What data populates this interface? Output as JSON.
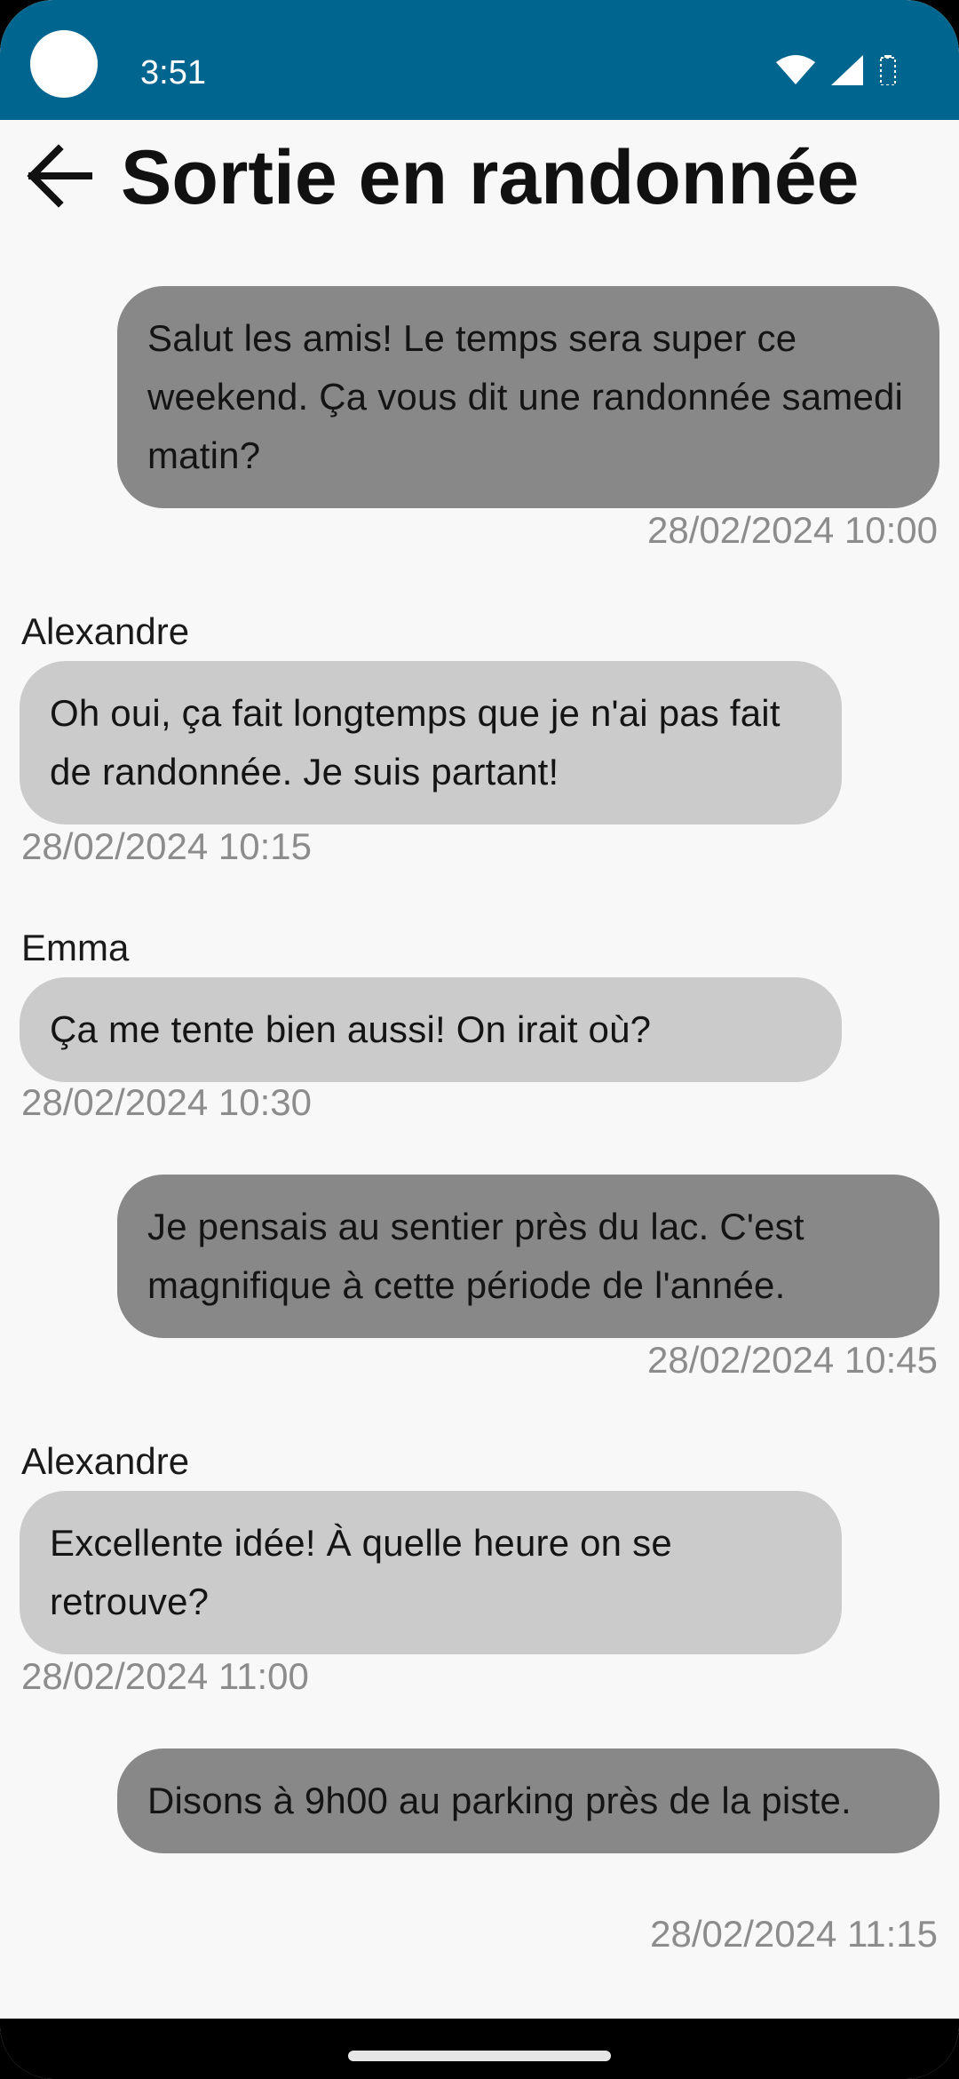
{
  "status_bar": {
    "time": "3:51",
    "icons": [
      "camera-cutout",
      "wifi-icon",
      "signal-icon",
      "battery-icon"
    ]
  },
  "header": {
    "back_icon": "arrow-left-icon",
    "title": "Sortie en randonnée"
  },
  "messages": [
    {
      "direction": "outgoing",
      "sender": "",
      "text": "Salut les amis! Le temps sera super ce weekend. Ça vous dit une randonnée samedi matin?",
      "timestamp": "28/02/2024 10:00"
    },
    {
      "direction": "incoming",
      "sender": "Alexandre",
      "text": "Oh oui, ça fait longtemps que je n'ai pas fait de randonnée. Je suis partant!",
      "timestamp": "28/02/2024 10:15"
    },
    {
      "direction": "incoming",
      "sender": "Emma",
      "text": "Ça me tente bien aussi! On irait où?",
      "timestamp": "28/02/2024 10:30"
    },
    {
      "direction": "outgoing",
      "sender": "",
      "text": "Je pensais au sentier près du lac. C'est magnifique à cette période de l'année.",
      "timestamp": "28/02/2024 10:45"
    },
    {
      "direction": "incoming",
      "sender": "Alexandre",
      "text": "Excellente idée! À quelle heure on se retrouve?",
      "timestamp": "28/02/2024 11:00"
    },
    {
      "direction": "outgoing",
      "sender": "",
      "text": "Disons à 9h00 au parking près de la piste.",
      "timestamp": "28/02/2024 11:15"
    }
  ],
  "colors": {
    "status_bar": "#006690",
    "background": "#f8f8f8",
    "outgoing_bubble": "#888888",
    "incoming_bubble": "#cbcbcb",
    "timestamp": "#8c8c8c"
  }
}
